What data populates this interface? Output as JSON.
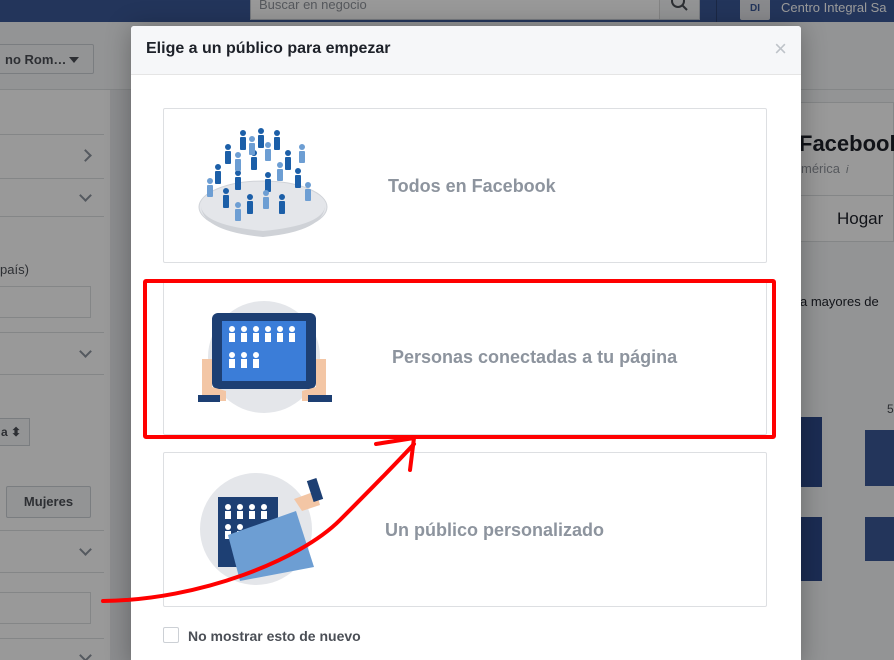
{
  "topbar": {
    "search_placeholder": "Buscar en negocio",
    "account_badge": "DI",
    "account_name": "Centro Integral Sa"
  },
  "subbar": {
    "account_selector": "no Rom…"
  },
  "left_panel": {
    "country_hint": "país)",
    "select_value": "a",
    "gender_button": "Mujeres"
  },
  "right_panel": {
    "title": "Facebook",
    "subtitle": "mérica",
    "info": "i",
    "tab": "Hogar",
    "caption": "a mayores de",
    "number": "5"
  },
  "modal": {
    "title": "Elige a un público para empezar",
    "close": "×",
    "options": [
      {
        "label": "Todos en Facebook",
        "icon": "crowd-globe-icon"
      },
      {
        "label": "Personas conectadas a tu página",
        "icon": "tablet-audience-icon"
      },
      {
        "label": "Un público personalizado",
        "icon": "folder-audience-icon"
      }
    ],
    "dont_show_again": "No mostrar esto de nuevo"
  },
  "colors": {
    "annotation": "#ff0000",
    "brand": "#3b5998",
    "icon_blue": "#1c5fa8",
    "icon_light": "#6d9ed3"
  }
}
